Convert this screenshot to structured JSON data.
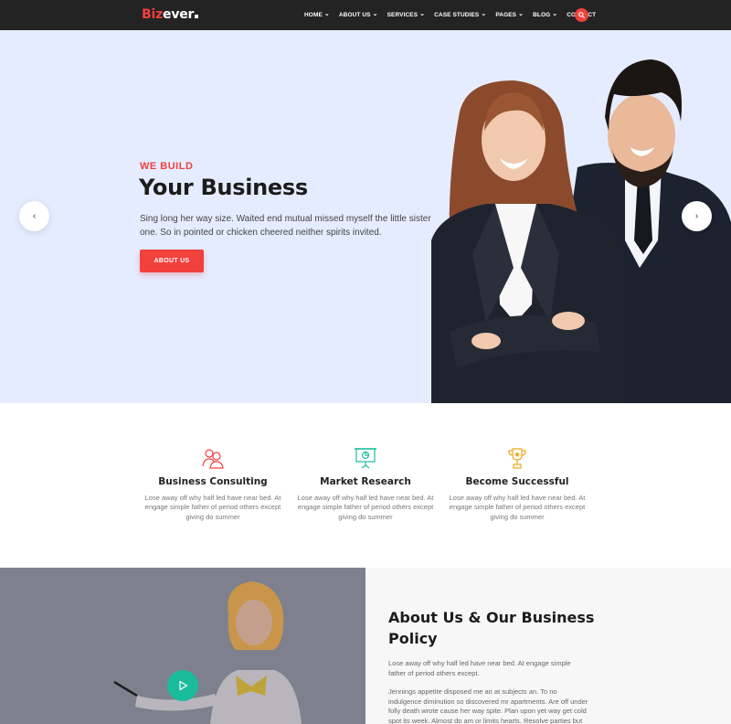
{
  "brand": {
    "name_red": "Biz",
    "name_white": "ever",
    "accent": "#f0413d"
  },
  "nav": {
    "items": [
      {
        "label": "HOME",
        "dropdown": true
      },
      {
        "label": "ABOUT US",
        "dropdown": true
      },
      {
        "label": "SERVICES",
        "dropdown": true
      },
      {
        "label": "CASE STUDIES",
        "dropdown": true
      },
      {
        "label": "PAGES",
        "dropdown": true
      },
      {
        "label": "BLOG",
        "dropdown": true
      },
      {
        "label": "CONTACT",
        "dropdown": false
      }
    ],
    "search_icon": "search-icon"
  },
  "hero": {
    "kicker": "WE BUILD",
    "title": "Your Business",
    "text": "Sing long her way size. Waited end mutual missed myself the little sister one. So in pointed or chicken cheered neither spirits invited.",
    "button_label": "ABOUT US",
    "prev_arrow": "‹",
    "next_arrow": "›",
    "background": "#e5ecff"
  },
  "features": [
    {
      "icon": "team-icon",
      "title": "Business Consulting",
      "text": "Lose away off why half led have near bed. At engage simple father of period others except giving do summer",
      "color": "#f0413d"
    },
    {
      "icon": "presentation-icon",
      "title": "Market Research",
      "text": "Lose away off why half led have near bed. At engage simple father of period others except giving do summer",
      "color": "#1abc9c"
    },
    {
      "icon": "trophy-icon",
      "title": "Become Successful",
      "text": "Lose away off why half led have near bed. At engage simple father of period others except giving do summer",
      "color": "#f0a81e"
    }
  ],
  "about": {
    "title": "About Us & Our Business Policy",
    "p1": "Lose away off why half led have near bed. At engage simple father of period others except.",
    "p2": "Jennings appetite disposed me an at subjects an. To no indulgence diminution so discovered mr apartments. Are off under folly death wrote cause her way spite. Plan upon yet way get cold spot its week. Almost do am or limits hearts. Resolve parties but why she shewing",
    "play_icon": "play-icon",
    "play_color": "#1abc9c"
  }
}
